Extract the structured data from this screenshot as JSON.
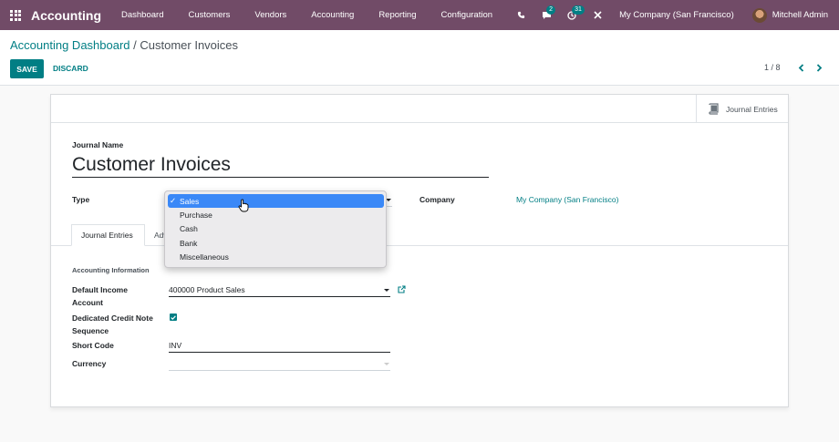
{
  "navbar": {
    "brand": "Accounting",
    "menu": [
      "Dashboard",
      "Customers",
      "Vendors",
      "Accounting",
      "Reporting",
      "Configuration"
    ],
    "messages_count": "2",
    "activities_count": "31",
    "company": "My Company (San Francisco)",
    "user": "Mitchell Admin",
    "icons": [
      "apps-grid-icon",
      "phone-icon",
      "chat-icon",
      "clock-icon",
      "debug-close-icon"
    ]
  },
  "control": {
    "breadcrumb_parent": "Accounting Dashboard",
    "breadcrumb_separator": " / ",
    "breadcrumb_current": "Customer Invoices",
    "save_label": "SAVE",
    "discard_label": "DISCARD",
    "pager": "1 / 8"
  },
  "form": {
    "smart_button_label": "Journal Entries",
    "journal_name_label": "Journal Name",
    "journal_name_value": "Customer Invoices",
    "type_label": "Type",
    "type_options": [
      "Sales",
      "Purchase",
      "Cash",
      "Bank",
      "Miscellaneous"
    ],
    "type_selected": "Sales",
    "check_glyph": "✓",
    "company_label": "Company",
    "company_value": "My Company (San Francisco)",
    "tabs": [
      "Journal Entries",
      "Adv"
    ],
    "group_title": "Accounting Information",
    "default_income_label_1": "Default Income",
    "default_income_label_2": "Account",
    "default_income_value": "400000 Product Sales",
    "credit_note_label_1": "Dedicated Credit Note",
    "credit_note_label_2": "Sequence",
    "credit_note_checked": true,
    "short_code_label": "Short Code",
    "short_code_value": "INV",
    "currency_label": "Currency",
    "currency_value": ""
  },
  "colors": {
    "navbar": "#714b67",
    "primary": "#017e84",
    "selected_option": "#3a88f7"
  }
}
